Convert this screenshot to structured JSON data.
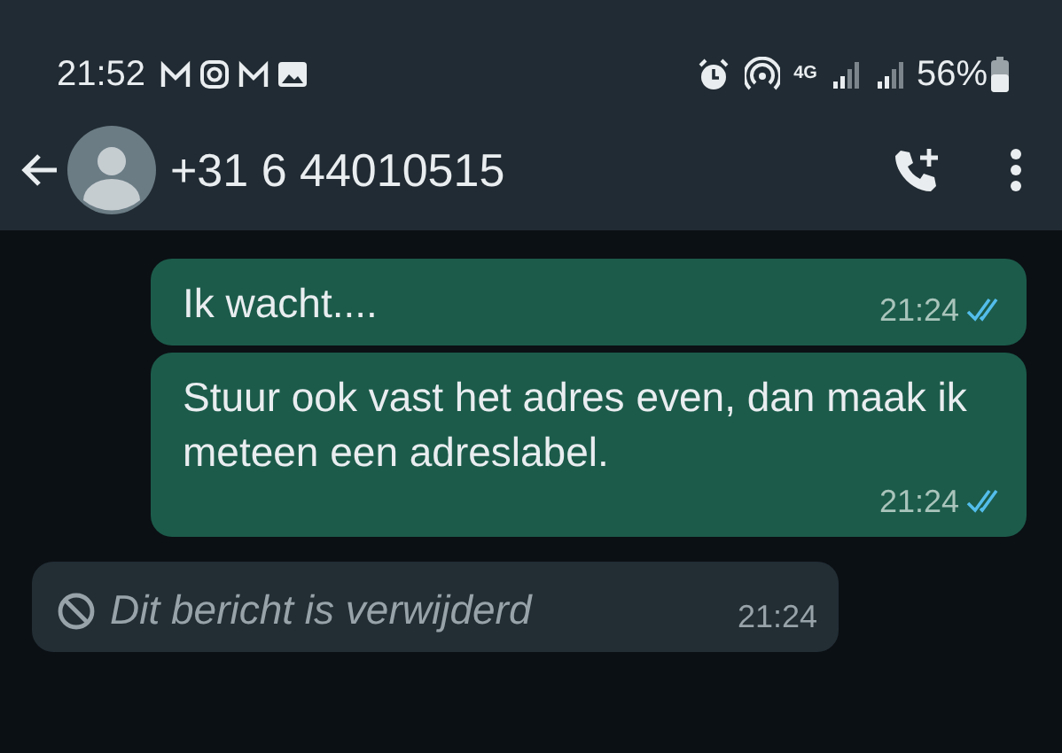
{
  "status_bar": {
    "time": "21:52",
    "network": "4G",
    "battery": "56%"
  },
  "header": {
    "contact": "+31 6 44010515"
  },
  "messages": [
    {
      "kind": "out",
      "text": "Ik wacht....",
      "time": "21:24",
      "read": true
    },
    {
      "kind": "out",
      "text": "Stuur ook vast het adres even, dan maak ik meteen een adreslabel.",
      "time": "21:24",
      "read": true
    },
    {
      "kind": "deleted",
      "text": "Dit bericht is verwijderd",
      "time": "21:24"
    }
  ]
}
